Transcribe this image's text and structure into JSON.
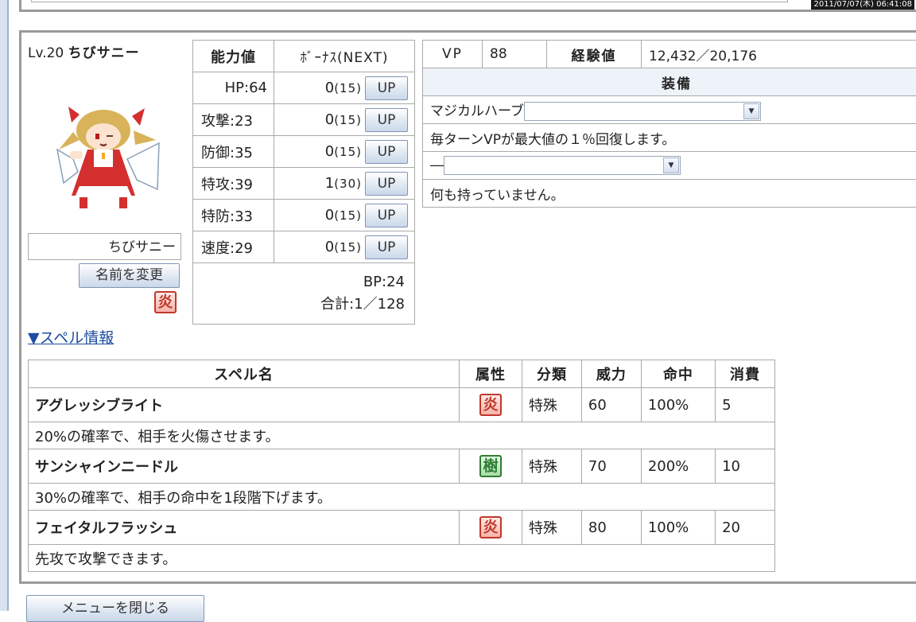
{
  "timestamp": "2011/07/07(木) 06:41:08",
  "character": {
    "level_label": "Lv.20",
    "name": "ちびサニー",
    "name_field": "ちびサニー",
    "rename_button": "名前を変更",
    "attribute": "炎"
  },
  "stats": {
    "headers": {
      "stat": "能力値",
      "bonus": "ﾎﾞｰﾅｽ(NEXT)"
    },
    "rows": [
      {
        "label": "HP:64",
        "bonus": "0",
        "next": "(15)",
        "up": "UP"
      },
      {
        "label": "攻撃:23",
        "bonus": "0",
        "next": "(15)",
        "up": "UP"
      },
      {
        "label": "防御:35",
        "bonus": "0",
        "next": "(15)",
        "up": "UP"
      },
      {
        "label": "特攻:39",
        "bonus": "1",
        "next": "(30)",
        "up": "UP"
      },
      {
        "label": "特防:33",
        "bonus": "0",
        "next": "(15)",
        "up": "UP"
      },
      {
        "label": "速度:29",
        "bonus": "0",
        "next": "(15)",
        "up": "UP"
      }
    ],
    "bp": "BP:24",
    "total": "合計:1／128"
  },
  "equipment": {
    "vp_label": "VP",
    "vp_value": "88",
    "exp_label": "経験値",
    "exp_value": "12,432／20,176",
    "header": "装備",
    "slot1_label": "マジカルハーブ",
    "slot1_desc": "毎ターンVPが最大値の１％回復します。",
    "slot2_label": "―",
    "slot2_desc": "何も持っていません。"
  },
  "spell_link": "▼スペル情報",
  "spell_table": {
    "headers": {
      "name": "スペル名",
      "attr": "属性",
      "cat": "分類",
      "power": "威力",
      "acc": "命中",
      "cost": "消費"
    },
    "spells": [
      {
        "name": "アグレッシブライト",
        "attr": "炎",
        "cat": "特殊",
        "power": "60",
        "acc": "100%",
        "cost": "5",
        "desc": "20%の確率で、相手を火傷させます。"
      },
      {
        "name": "サンシャインニードル",
        "attr": "樹",
        "cat": "特殊",
        "power": "70",
        "acc": "200%",
        "cost": "10",
        "desc": "30%の確率で、相手の命中を1段階下げます。"
      },
      {
        "name": "フェイタルフラッシュ",
        "attr": "炎",
        "cat": "特殊",
        "power": "80",
        "acc": "100%",
        "cost": "20",
        "desc": "先攻で攻撃できます。"
      }
    ]
  },
  "close_menu": "メニューを閉じる",
  "colors": {
    "fire": "#c0392b",
    "tree": "#2e7d32",
    "link": "#1d4ca0",
    "panel_border": "#9a9a9a"
  },
  "icons": {
    "attr_fire": "fire-attribute-icon",
    "attr_tree": "tree-attribute-icon",
    "dropdown": "chevron-down-icon"
  }
}
